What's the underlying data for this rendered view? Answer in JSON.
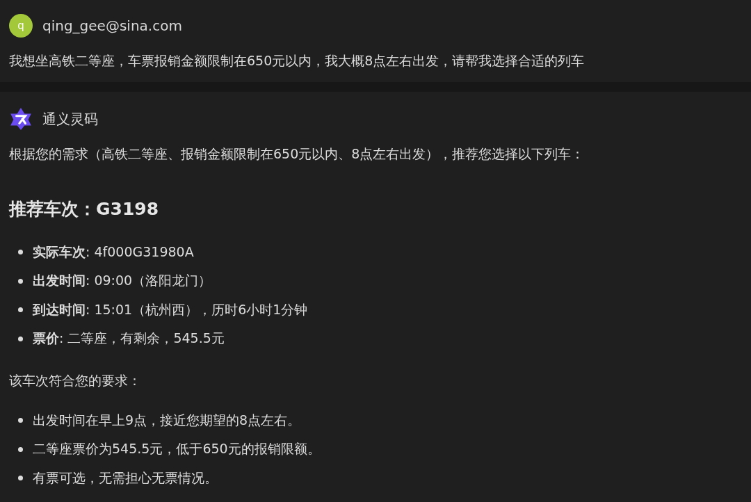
{
  "user_message": {
    "avatar_letter": "q",
    "email": "qing_gee@sina.com",
    "text": "我想坐高铁二等座，车票报销金额限制在650元以内，我大概8点左右出发，请帮我选择合适的列车"
  },
  "assistant_message": {
    "name": "通义灵码",
    "intro": "根据您的需求（高铁二等座、报销金额限制在650元以内、8点左右出发），推荐您选择以下列车：",
    "heading": "推荐车次：G3198",
    "details": [
      "**实际车次**: 4f000G31980A",
      "**出发时间**: 09:00（洛阳龙门）",
      "**到达时间**: 15:01（杭州西），历时6小时1分钟",
      "**票价**: 二等座，有剩余，545.5元"
    ],
    "reason_intro": "该车次符合您的要求：",
    "reasons": [
      "出发时间在早上9点，接近您期望的8点左右。",
      "二等座票价为545.5元，低于650元的报销限额。",
      "有票可选，无需担心无票情况。"
    ]
  }
}
